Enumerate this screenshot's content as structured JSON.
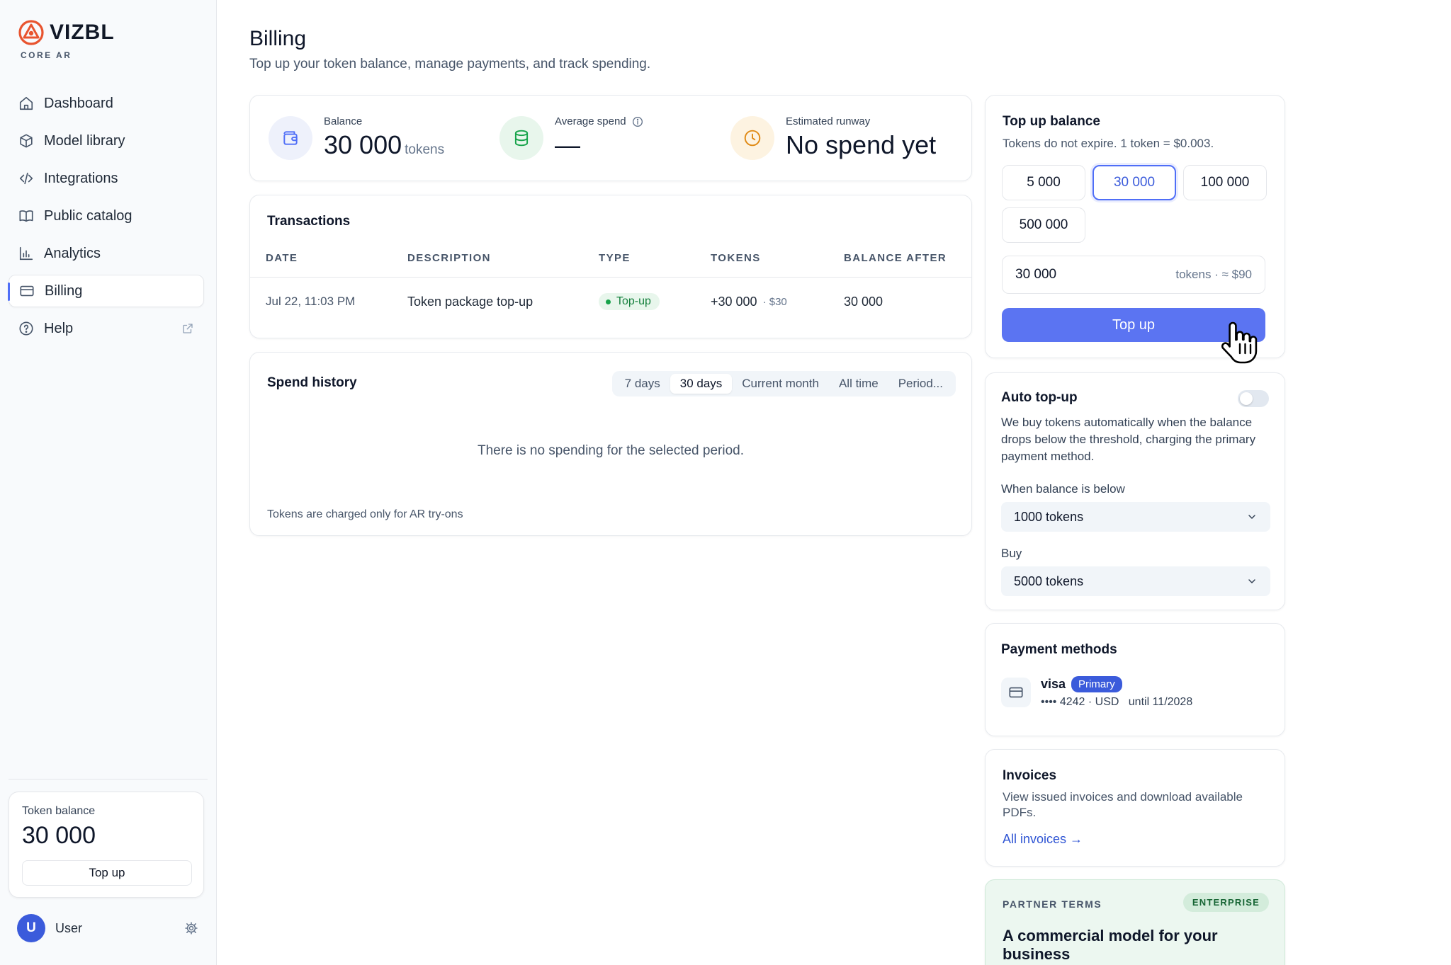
{
  "brand": {
    "name": "VIZBL",
    "subtitle": "CORE AR",
    "accent": "#e8542f"
  },
  "sidebar": {
    "items": [
      {
        "label": "Dashboard",
        "icon": "home-icon"
      },
      {
        "label": "Model library",
        "icon": "cube-icon"
      },
      {
        "label": "Integrations",
        "icon": "code-icon"
      },
      {
        "label": "Public catalog",
        "icon": "book-icon"
      },
      {
        "label": "Analytics",
        "icon": "bar-chart-icon"
      },
      {
        "label": "Billing",
        "icon": "credit-card-icon",
        "active": true
      },
      {
        "label": "Help",
        "icon": "help-circle-icon",
        "external": true
      }
    ],
    "token_card": {
      "label": "Token balance",
      "value": "30 000",
      "button": "Top up"
    },
    "user": {
      "initial": "U",
      "name": "User"
    }
  },
  "page": {
    "title": "Billing",
    "subtitle": "Top up your token balance, manage payments, and track spending."
  },
  "stats": {
    "balance": {
      "label": "Balance",
      "value": "30 000",
      "unit": "tokens",
      "icon": "wallet-icon"
    },
    "average": {
      "label": "Average spend",
      "value": "—",
      "icon": "database-icon"
    },
    "runway": {
      "label": "Estimated runway",
      "value": "No spend yet",
      "icon": "clock-icon"
    }
  },
  "transactions": {
    "title": "Transactions",
    "columns": [
      "DATE",
      "DESCRIPTION",
      "TYPE",
      "TOKENS",
      "BALANCE AFTER"
    ],
    "rows": [
      {
        "date": "Jul 22, 11:03 PM",
        "description": "Token package top-up",
        "type": "Top-up",
        "tokens": "+30 000",
        "tokens_sub": "· $30",
        "balance_after": "30 000"
      }
    ]
  },
  "spend_history": {
    "title": "Spend history",
    "periods": [
      "7 days",
      "30 days",
      "Current month",
      "All time",
      "Period..."
    ],
    "active_period": "30 days",
    "empty": "There is no spending for the selected period.",
    "note": "Tokens are charged only for AR try-ons"
  },
  "topup": {
    "title": "Top up balance",
    "subtitle": "Tokens do not expire. 1 token = $0.003.",
    "amounts": [
      "5 000",
      "30 000",
      "100 000",
      "500 000"
    ],
    "selected": "30 000",
    "input_value": "30 000",
    "input_suffix": "tokens · ≈ $90",
    "button": "Top up",
    "button_color": "#5b74f2"
  },
  "auto_topup": {
    "title": "Auto top-up",
    "enabled": false,
    "description": "We buy tokens automatically when the balance drops below the threshold, charging the primary payment method.",
    "threshold_label": "When balance is below",
    "threshold_value": "1000 tokens",
    "buy_label": "Buy",
    "buy_value": "5000 tokens"
  },
  "payment_methods": {
    "title": "Payment methods",
    "brand": "visa",
    "badge": "Primary",
    "details": "•••• 4242 · USD   until 11/2028"
  },
  "invoices": {
    "title": "Invoices",
    "description": "View issued invoices and download available PDFs.",
    "link": "All invoices →"
  },
  "partner": {
    "label": "PARTNER TERMS",
    "badge": "ENTERPRISE",
    "headline": "A commercial model for your business"
  }
}
